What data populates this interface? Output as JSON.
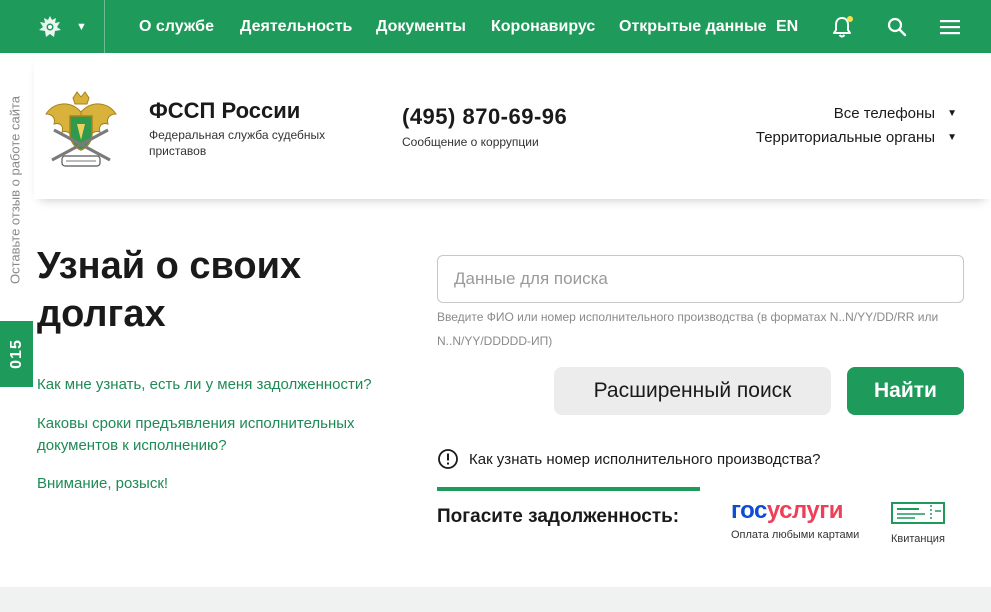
{
  "topnav": {
    "items": [
      {
        "label": "О службе"
      },
      {
        "label": "Деятельность"
      },
      {
        "label": "Документы"
      },
      {
        "label": "Коронавирус"
      },
      {
        "label": "Открытые данные"
      }
    ],
    "lang": "EN",
    "icons": [
      "emblem-icon",
      "chevron-down-icon",
      "bell-icon",
      "search-icon",
      "menu-icon"
    ]
  },
  "side": {
    "feedback": "Оставьте отзыв о работе сайта",
    "badge": "015"
  },
  "header": {
    "org_name": "ФССП России",
    "org_sub": "Федеральная служба судебных приставов",
    "phone": "(495) 870-69-96",
    "phone_sub": "Сообщение о коррупции",
    "all_phones": "Все телефоны",
    "territorial": "Территориальные органы"
  },
  "main": {
    "title": "Узнай о своих долгах",
    "links": [
      "Как мне узнать, есть ли у меня задолженности?",
      "Каковы сроки предъявления исполнительных документов к исполнению?",
      "Внимание, розыск!"
    ],
    "search_placeholder": "Данные для поиска",
    "hint": "Введите ФИО или номер исполнительного производства (в форматах N..N/YY/DD/RR или N..N/YY/DDDDD-ИП)",
    "advanced_button": "Расширенный поиск",
    "find_button": "Найти",
    "how_to_know": "Как узнать номер исполнительного производства?",
    "pay_label": "Погасите задолженность:",
    "gosuslugi_gos": "гос",
    "gosuslugi_usl": "услуги",
    "gosuslugi_caption": "Оплата любыми картами",
    "receipt_caption": "Квитанция"
  },
  "colors": {
    "brand_green": "#1e9a5a",
    "link_green": "#1e8a55",
    "gos_blue": "#0d4cd3",
    "gos_red": "#ee3f58"
  }
}
